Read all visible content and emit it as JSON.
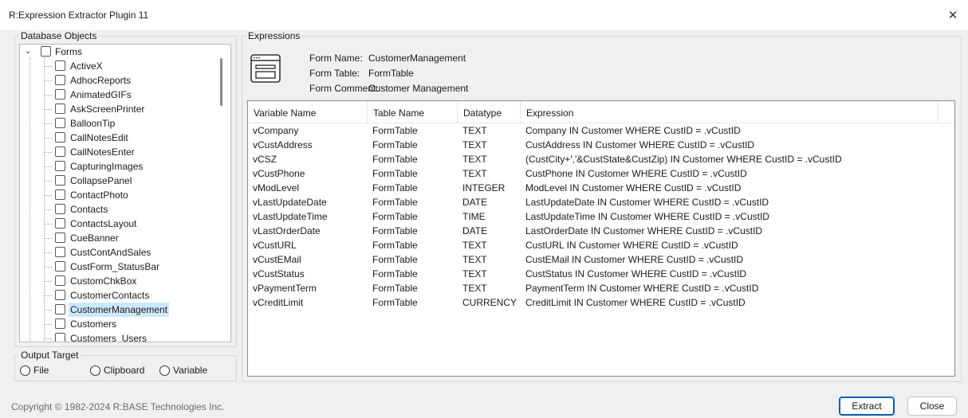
{
  "window": {
    "title": "R:Expression Extractor Plugin 11",
    "close_glyph": "✕"
  },
  "database_objects": {
    "label": "Database Objects",
    "root": {
      "label": "Forms",
      "expander": "⌄"
    },
    "items": [
      "ActiveX",
      "AdhocReports",
      "AnimatedGIFs",
      "AskScreenPrinter",
      "BalloonTip",
      "CallNotesEdit",
      "CallNotesEnter",
      "CapturingImages",
      "CollapsePanel",
      "ContactPhoto",
      "Contacts",
      "ContactsLayout",
      "CueBanner",
      "CustContAndSales",
      "CustForm_StatusBar",
      "CustomChkBox",
      "CustomerContacts",
      "CustomerManagement",
      "Customers",
      "Customers_Users"
    ],
    "selected": "CustomerManagement"
  },
  "output_target": {
    "label": "Output Target",
    "options": [
      "File",
      "Clipboard",
      "Variable"
    ]
  },
  "expressions": {
    "label": "Expressions",
    "form_name_label": "Form Name:",
    "form_name": "CustomerManagement",
    "form_table_label": "Form Table:",
    "form_table": "FormTable",
    "form_comment_label": "Form Comment:",
    "form_comment": "Customer Management",
    "columns": [
      "Variable Name",
      "Table Name",
      "Datatype",
      "Expression"
    ],
    "rows": [
      [
        "vCompany",
        "FormTable",
        "TEXT",
        "Company IN Customer WHERE CustID = .vCustID"
      ],
      [
        "vCustAddress",
        "FormTable",
        "TEXT",
        "CustAddress IN Customer WHERE CustID = .vCustID"
      ],
      [
        "vCSZ",
        "FormTable",
        "TEXT",
        "(CustCity+','&CustState&CustZip) IN Customer WHERE CustID = .vCustID"
      ],
      [
        "vCustPhone",
        "FormTable",
        "TEXT",
        "CustPhone IN Customer WHERE CustID = .vCustID"
      ],
      [
        "vModLevel",
        "FormTable",
        "INTEGER",
        "ModLevel IN Customer WHERE CustID = .vCustID"
      ],
      [
        "vLastUpdateDate",
        "FormTable",
        "DATE",
        "LastUpdateDate IN Customer WHERE CustID = .vCustID"
      ],
      [
        "vLastUpdateTime",
        "FormTable",
        "TIME",
        "LastUpdateTime IN Customer WHERE CustID = .vCustID"
      ],
      [
        "vLastOrderDate",
        "FormTable",
        "DATE",
        "LastOrderDate IN Customer WHERE CustID = .vCustID"
      ],
      [
        "vCustURL",
        "FormTable",
        "TEXT",
        "CustURL IN Customer WHERE CustID = .vCustID"
      ],
      [
        "vCustEMail",
        "FormTable",
        "TEXT",
        "CustEMail IN Customer WHERE CustID = .vCustID"
      ],
      [
        "vCustStatus",
        "FormTable",
        "TEXT",
        "CustStatus IN Customer WHERE CustID = .vCustID"
      ],
      [
        "vPaymentTerm",
        "FormTable",
        "TEXT",
        "PaymentTerm IN Customer WHERE CustID = .vCustID"
      ],
      [
        "vCreditLimit",
        "FormTable",
        "CURRENCY",
        "CreditLimit IN Customer WHERE CustID = .vCustID"
      ]
    ]
  },
  "footer": {
    "copyright": "Copyright © 1982-2024 R:BASE Technologies Inc.",
    "extract_label": "Extract",
    "close_label": "Close"
  },
  "colors": {
    "selection": "#cce8ff",
    "primary_border": "#005fb8"
  },
  "icons": {
    "form": "form-window-icon",
    "close": "close-icon"
  }
}
